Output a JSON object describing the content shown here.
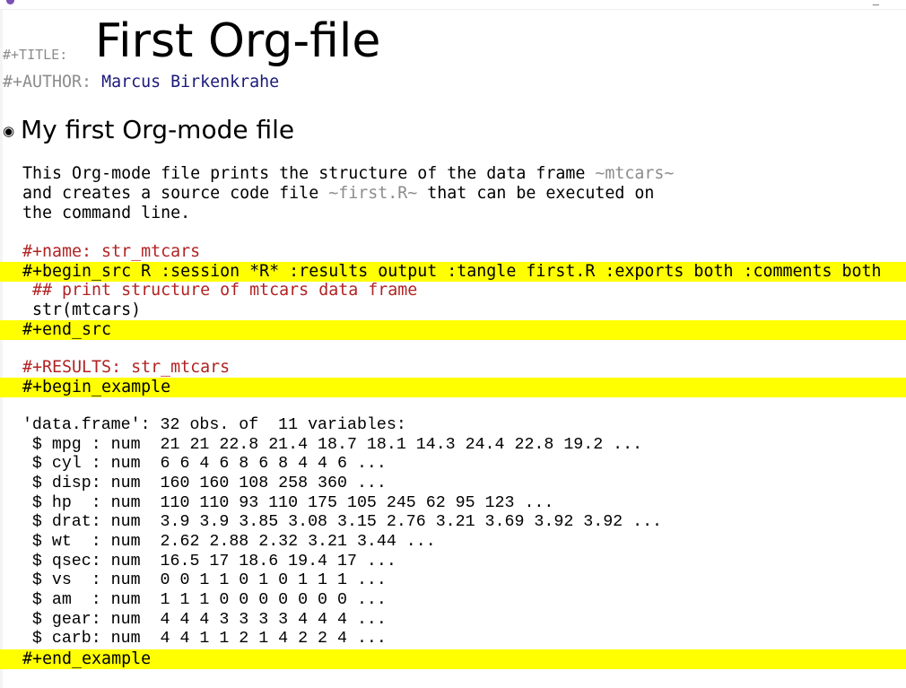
{
  "window": {
    "minimize_label": "_"
  },
  "header": {
    "title_keyword": "#+TITLE:",
    "title": "First Org-file",
    "author_keyword": "#+AUTHOR:",
    "author": "Marcus Birkenkrahe"
  },
  "heading": {
    "bullet": "◉",
    "text": "My first Org-mode file"
  },
  "body": {
    "line1_a": "  This Org-mode file prints the structure of the data frame ",
    "line1_verb": "~mtcars~",
    "line2_a": "  and creates a source code file ",
    "line2_verb": "~first.R~",
    "line2_b": " that can be executed on",
    "line3": "  the command line."
  },
  "src_block": {
    "name": "  #+name: str_mtcars",
    "begin": "  #+begin_src R :session *R* :results output :tangle first.R :exports both :comments both",
    "comment": "   ## print structure of mtcars data frame",
    "code": "   str(mtcars)",
    "end": "  #+end_src"
  },
  "results": {
    "label": "  #+RESULTS: str_mtcars",
    "begin": "  #+begin_example",
    "lines": [
      "  'data.frame': 32 obs. of  11 variables:",
      "   $ mpg : num  21 21 22.8 21.4 18.7 18.1 14.3 24.4 22.8 19.2 ...",
      "   $ cyl : num  6 6 4 6 8 6 8 4 4 6 ...",
      "   $ disp: num  160 160 108 258 360 ...",
      "   $ hp  : num  110 110 93 110 175 105 245 62 95 123 ...",
      "   $ drat: num  3.9 3.9 3.85 3.08 3.15 2.76 3.21 3.69 3.92 3.92 ...",
      "   $ wt  : num  2.62 2.88 2.32 3.21 3.44 ...",
      "   $ qsec: num  16.5 17 18.6 19.4 17 ...",
      "   $ vs  : num  0 0 1 1 0 1 0 1 1 1 ...",
      "   $ am  : num  1 1 1 0 0 0 0 0 0 0 ...",
      "   $ gear: num  4 4 4 3 3 3 3 4 4 4 ...",
      "   $ carb: num  4 4 1 1 2 1 4 2 2 4 ..."
    ],
    "end": "  #+end_example"
  }
}
